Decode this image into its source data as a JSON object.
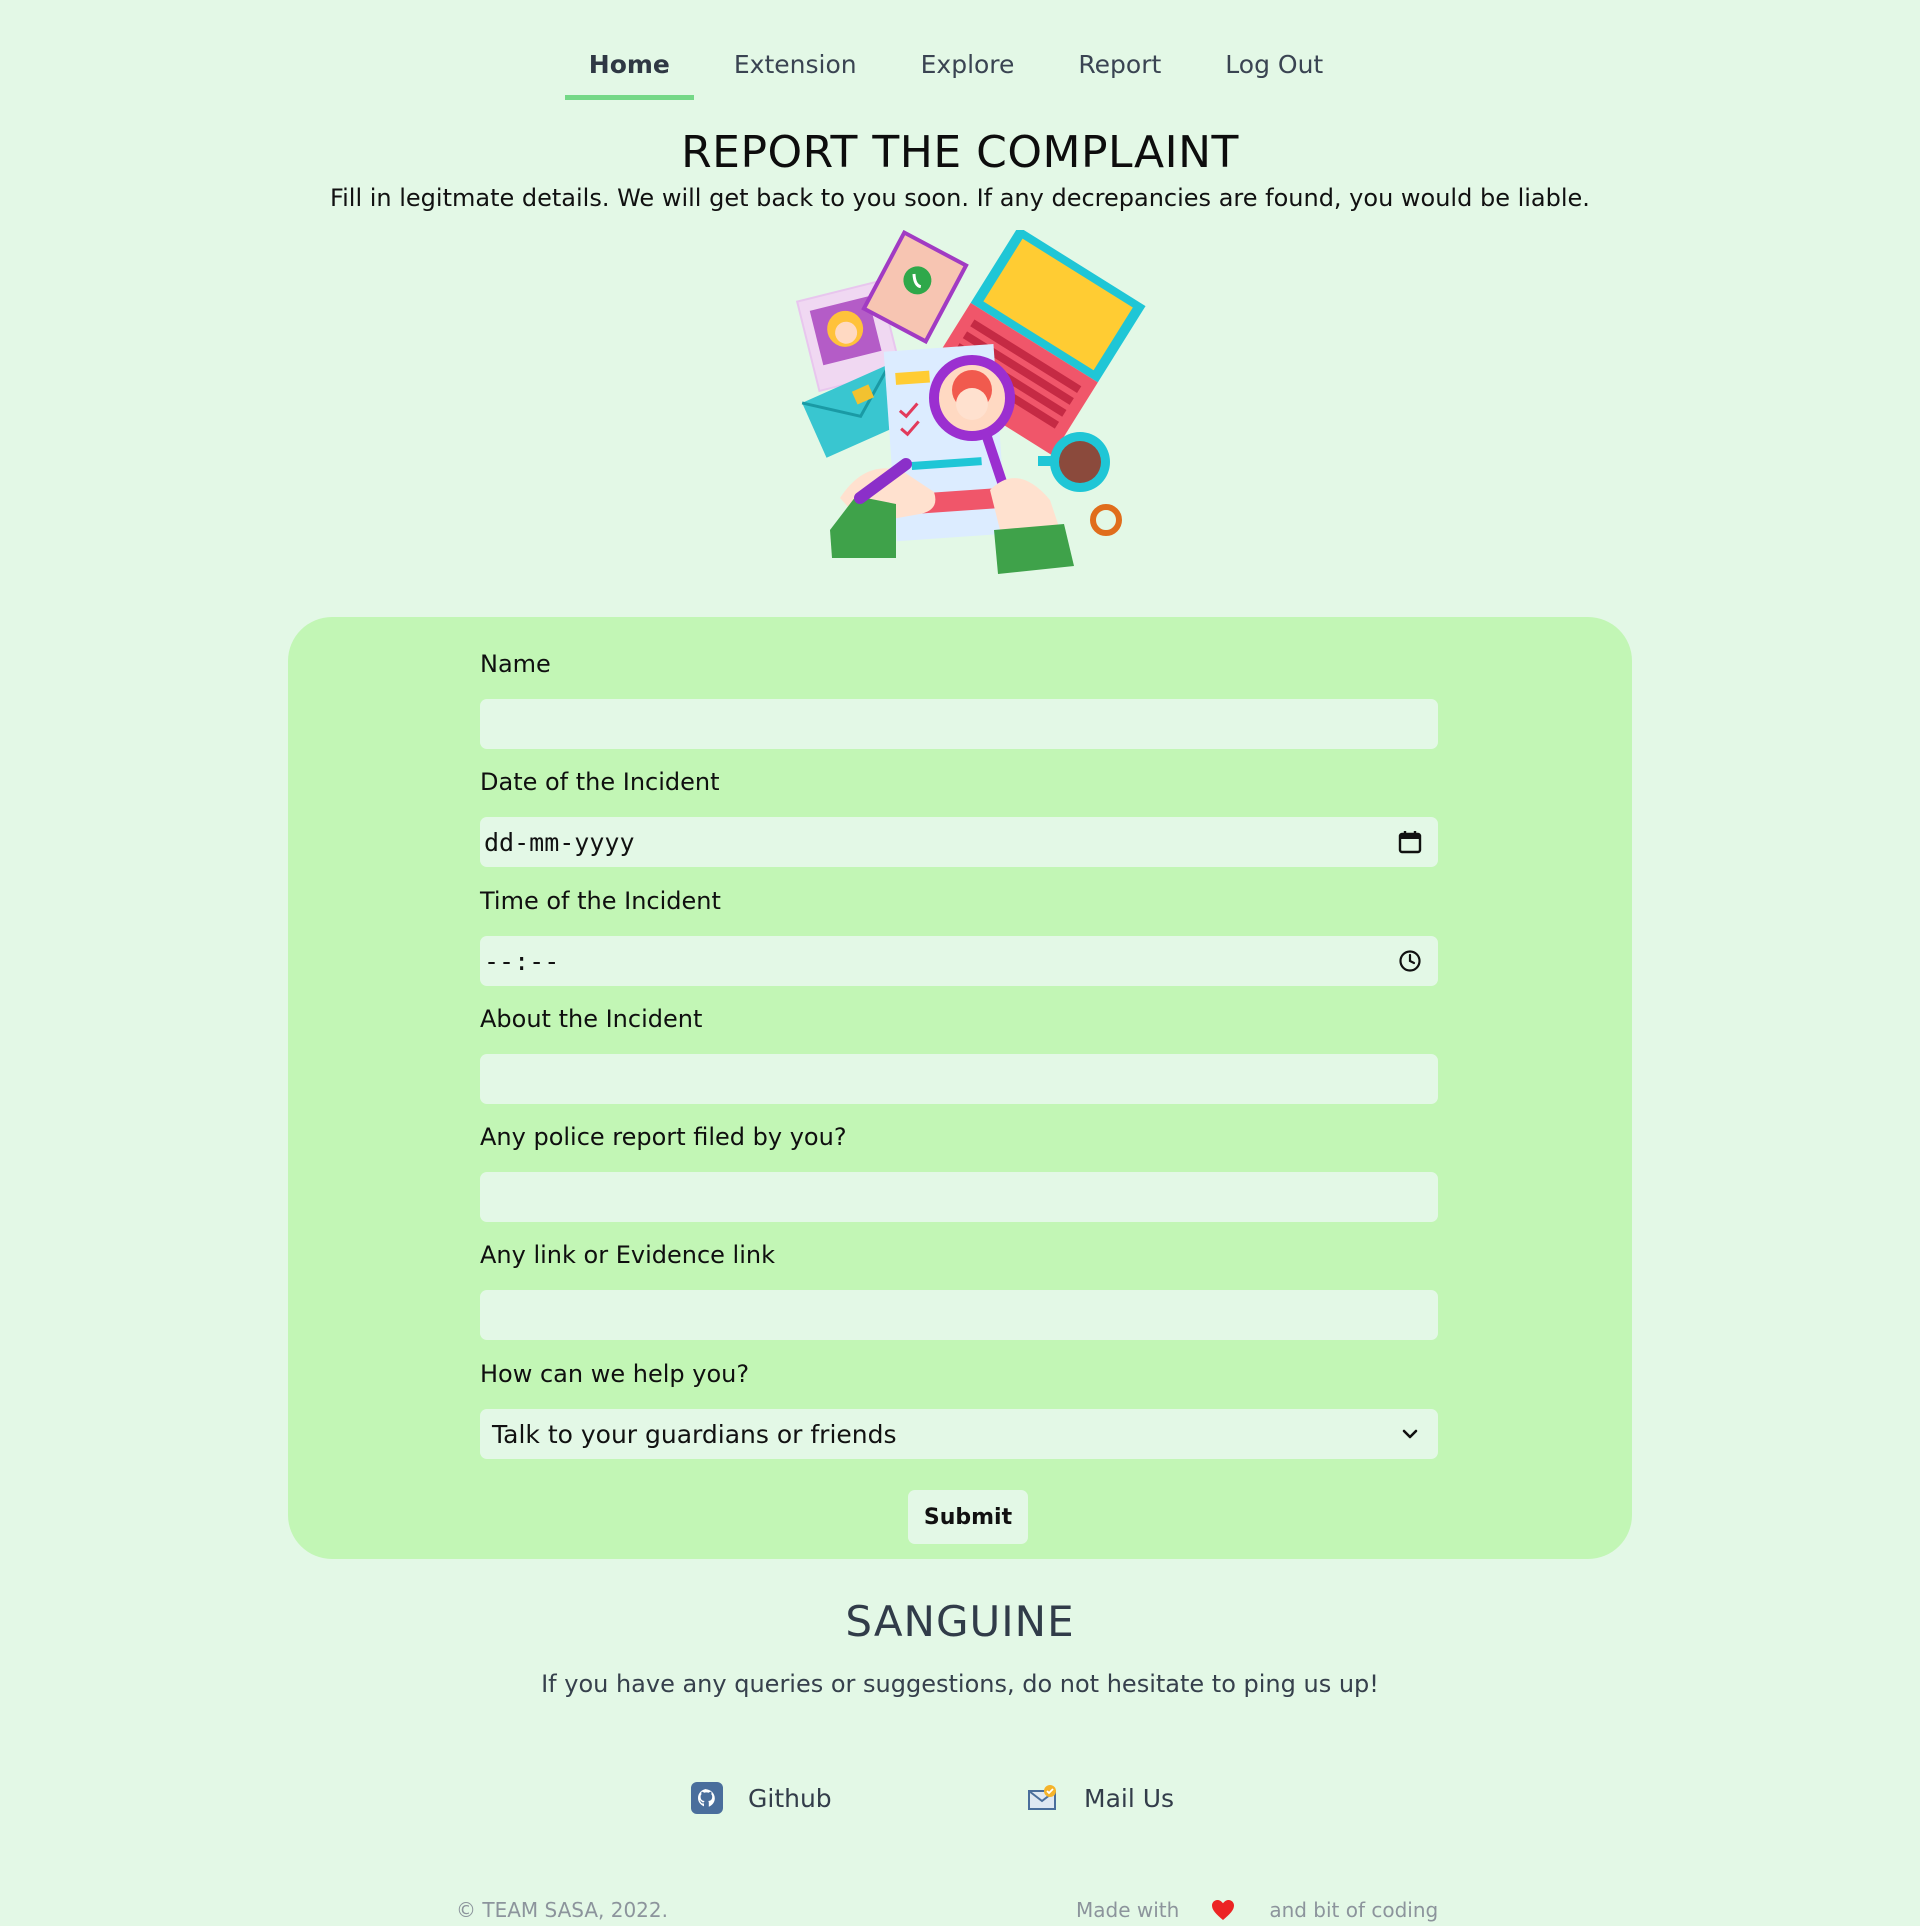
{
  "nav": {
    "items": [
      {
        "label": "Home",
        "active": true
      },
      {
        "label": "Extension",
        "active": false
      },
      {
        "label": "Explore",
        "active": false
      },
      {
        "label": "Report",
        "active": false
      },
      {
        "label": "Log Out",
        "active": false
      }
    ]
  },
  "header": {
    "title": "REPORT THE COMPLAINT",
    "subtitle": "Fill in legitmate details. We will get back to you soon. If any decrepancies are found, you would be liable."
  },
  "form": {
    "name_label": "Name",
    "name_value": "",
    "date_label": "Date of the Incident",
    "date_value": "dd-mm-yyyy",
    "time_label": "Time of the Incident",
    "time_value": "--:--",
    "about_label": "About the Incident",
    "about_value": "",
    "police_label": "Any police report filed by you?",
    "police_value": "",
    "evidence_label": "Any link or Evidence link",
    "evidence_value": "",
    "help_label": "How can we help you?",
    "help_selected": "Talk to your guardians or friends",
    "submit_label": "Submit"
  },
  "footer": {
    "brand": "SANGUINE",
    "tagline": "If you have any queries or suggestions, do not hesitate to ping us up!",
    "github_label": "Github",
    "mail_label": "Mail Us",
    "copyright": "© TEAM SASA, 2022.",
    "made_with": "Made with",
    "coding_text": "and bit of coding"
  },
  "colors": {
    "page_bg": "#e3f8e6",
    "card_bg": "#c2f6b5",
    "active_underline": "#74d887",
    "heart": "#ec2424"
  },
  "icons": {
    "date_field": "calendar-icon",
    "time_field": "clock-icon",
    "select": "chevron-down-icon",
    "github": "github-icon",
    "mail": "mail-icon",
    "heart": "heart-icon"
  }
}
